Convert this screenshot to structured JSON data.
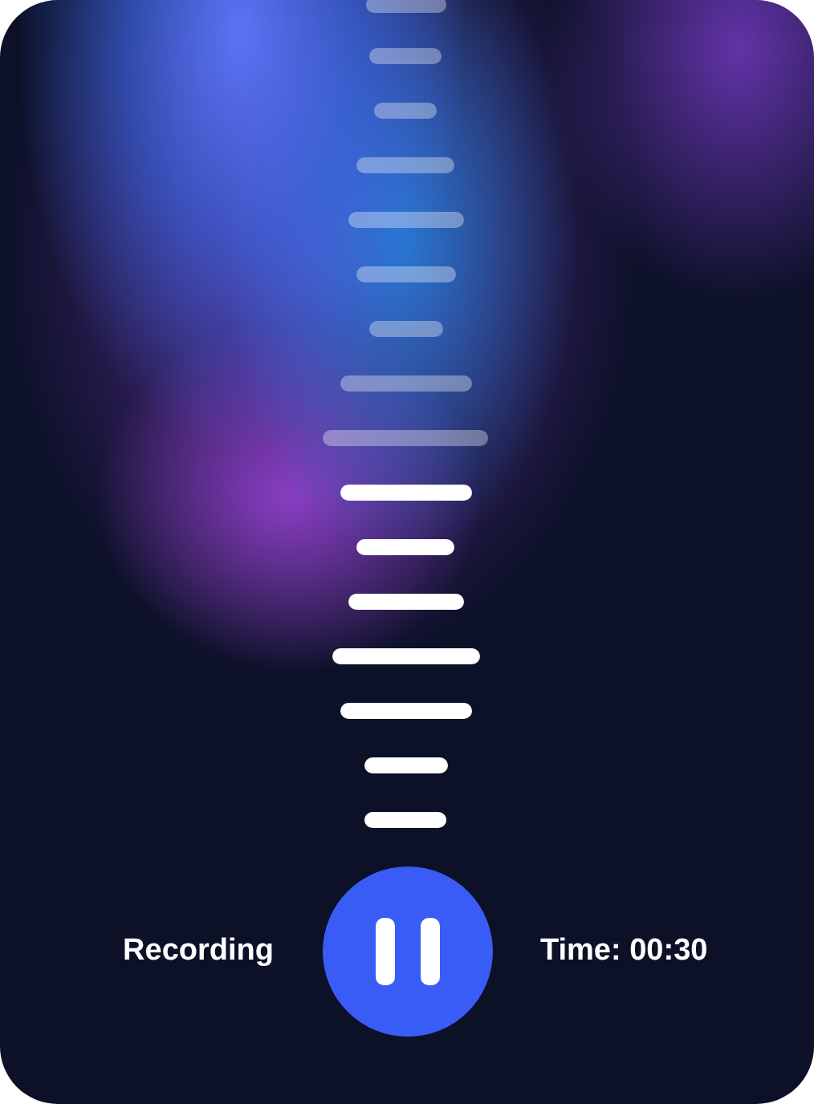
{
  "status": {
    "label": "Recording"
  },
  "timer": {
    "label": "Time: 00:30"
  }
}
